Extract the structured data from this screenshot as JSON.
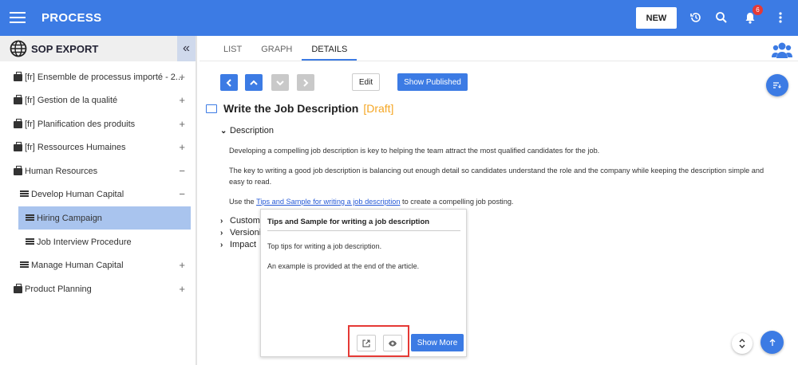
{
  "header": {
    "title": "PROCESS",
    "new_label": "NEW",
    "notification_count": "6",
    "icons": [
      "menu-icon",
      "history-icon",
      "search-icon",
      "bell-icon",
      "more-vertical-icon"
    ]
  },
  "sidebar": {
    "title": "SOP EXPORT",
    "collapse_symbol": "«",
    "items": [
      {
        "label": "[fr] Ensemble de processus importé - 2...",
        "toggle": "+",
        "icon": "briefcase-icon"
      },
      {
        "label": "[fr] Gestion de la qualité",
        "toggle": "+",
        "icon": "briefcase-icon"
      },
      {
        "label": "[fr] Planification des produits",
        "toggle": "+",
        "icon": "briefcase-icon"
      },
      {
        "label": "[fr] Ressources Humaines",
        "toggle": "+",
        "icon": "briefcase-icon"
      },
      {
        "label": "Human Resources",
        "toggle": "−",
        "icon": "briefcase-icon"
      },
      {
        "label": "Develop Human Capital",
        "toggle": "−",
        "icon": "list-icon"
      },
      {
        "label": "Hiring Campaign",
        "toggle": "",
        "icon": "list-icon"
      },
      {
        "label": "Job Interview Procedure",
        "toggle": "",
        "icon": "list-icon"
      },
      {
        "label": "Manage Human Capital",
        "toggle": "+",
        "icon": "list-icon"
      },
      {
        "label": "Product Planning",
        "toggle": "+",
        "icon": "briefcase-icon"
      }
    ]
  },
  "tabs": [
    "LIST",
    "GRAPH",
    "DETAILS"
  ],
  "toolbar": {
    "edit_label": "Edit",
    "show_published_label": "Show Published"
  },
  "detail": {
    "title": "Write the Job Description",
    "status": "[Draft]",
    "description_label": "Description",
    "para1": "Developing a compelling job description is key to helping the team attract the most qualified candidates for the job.",
    "para2": "The key to writing a good job description is balancing out enough detail so candidates understand the role and the company while keeping the description simple and easy to read.",
    "para3_prefix": "Use the ",
    "para3_link": "Tips and Sample for writing a job description",
    "para3_suffix": " to create a compelling job posting.",
    "sections": [
      "Custom",
      "Versionin",
      "Impact"
    ]
  },
  "popup": {
    "title": "Tips and Sample for writing a job description",
    "line1": "Top tips for writing a job description.",
    "line2": "An example is provided at the end of the article.",
    "show_more_label": "Show More"
  },
  "colors": {
    "primary": "#3c7be4",
    "draft": "#f5a623",
    "highlight": "#e53935",
    "selected": "#a9c4ee"
  }
}
